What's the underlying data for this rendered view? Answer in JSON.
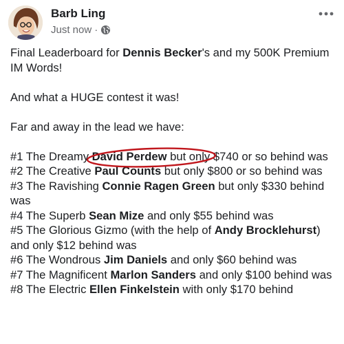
{
  "post": {
    "author": "Barb Ling",
    "timestamp": "Just now",
    "separator": "·",
    "privacy_icon": "globe-icon",
    "more_icon": "more-horizontal-icon"
  },
  "body": {
    "intro_1": "Final Leaderboard for ",
    "intro_name": "Dennis Becker",
    "intro_2": "'s and my 500K Premium IM Words!",
    "line_2": "And what a HUGE contest it was!",
    "line_3": "Far and away in the lead we have:",
    "entries": [
      {
        "prefix": "#1  The Dreamy ",
        "name": "David Perdew",
        "suffix": " but only $740 or so behind was"
      },
      {
        "prefix": "#2  The Creative ",
        "name": "Paul Counts",
        "suffix": " but only $800 or so behind was"
      },
      {
        "prefix": "#3  The Ravishing ",
        "name": "Connie Ragen Green",
        "suffix": " but only $330 behind was"
      },
      {
        "prefix": "#4  The Superb ",
        "name": "Sean Mize",
        "suffix": " and only $55 behind was"
      },
      {
        "prefix": "#5  The Glorious Gizmo (with the help of ",
        "name": "Andy Brocklehurst",
        "suffix": ") and only $12 behind was"
      },
      {
        "prefix": "#6  The Wondrous ",
        "name": "Jim Daniels",
        "suffix": " and only $60 behind was"
      },
      {
        "prefix": "#7  The Magnificent ",
        "name": "Marlon Sanders",
        "suffix": " and only $100 behind was"
      },
      {
        "prefix": "#8  The Electric ",
        "name": "Ellen Finkelstein",
        "suffix": " with only $170 behind"
      }
    ]
  },
  "colors": {
    "text": "#1c1e21",
    "meta": "#65676b",
    "annotation_circle": "#c0161c"
  }
}
